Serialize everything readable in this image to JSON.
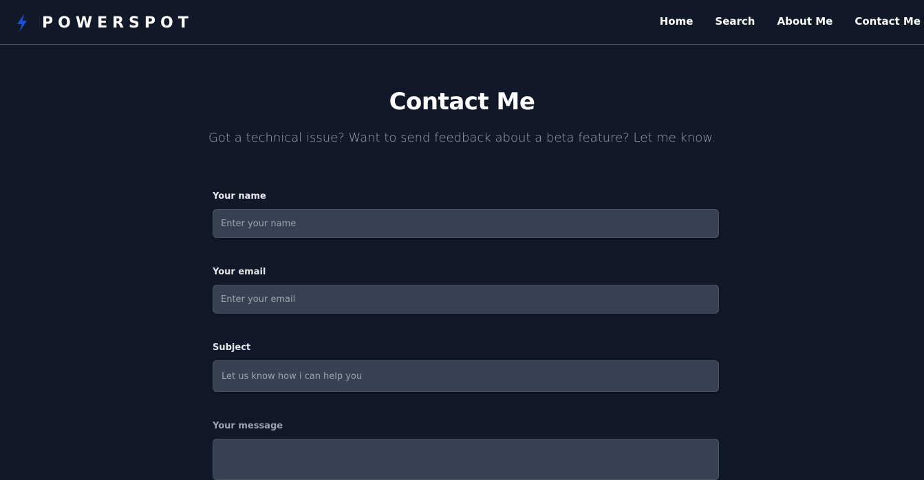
{
  "nav": {
    "logo_icon": "lightning-bolt-icon",
    "brand": "POWERSPOT",
    "links": [
      "Home",
      "Search",
      "About Me",
      "Contact Me"
    ]
  },
  "hero": {
    "title": "Contact Me",
    "subtitle": "Got a technical issue? Want to send feedback about a beta feature? Let me know."
  },
  "form": {
    "name": {
      "label": "Your name",
      "placeholder": "Enter your name"
    },
    "email": {
      "label": "Your email",
      "placeholder": "Enter your email"
    },
    "subject": {
      "label": "Subject",
      "placeholder": "Let us know how i can help you"
    },
    "message": {
      "label": "Your message"
    }
  },
  "colors": {
    "background": "#111827",
    "input_bg": "#374151",
    "accent": "#1d4ed8"
  }
}
